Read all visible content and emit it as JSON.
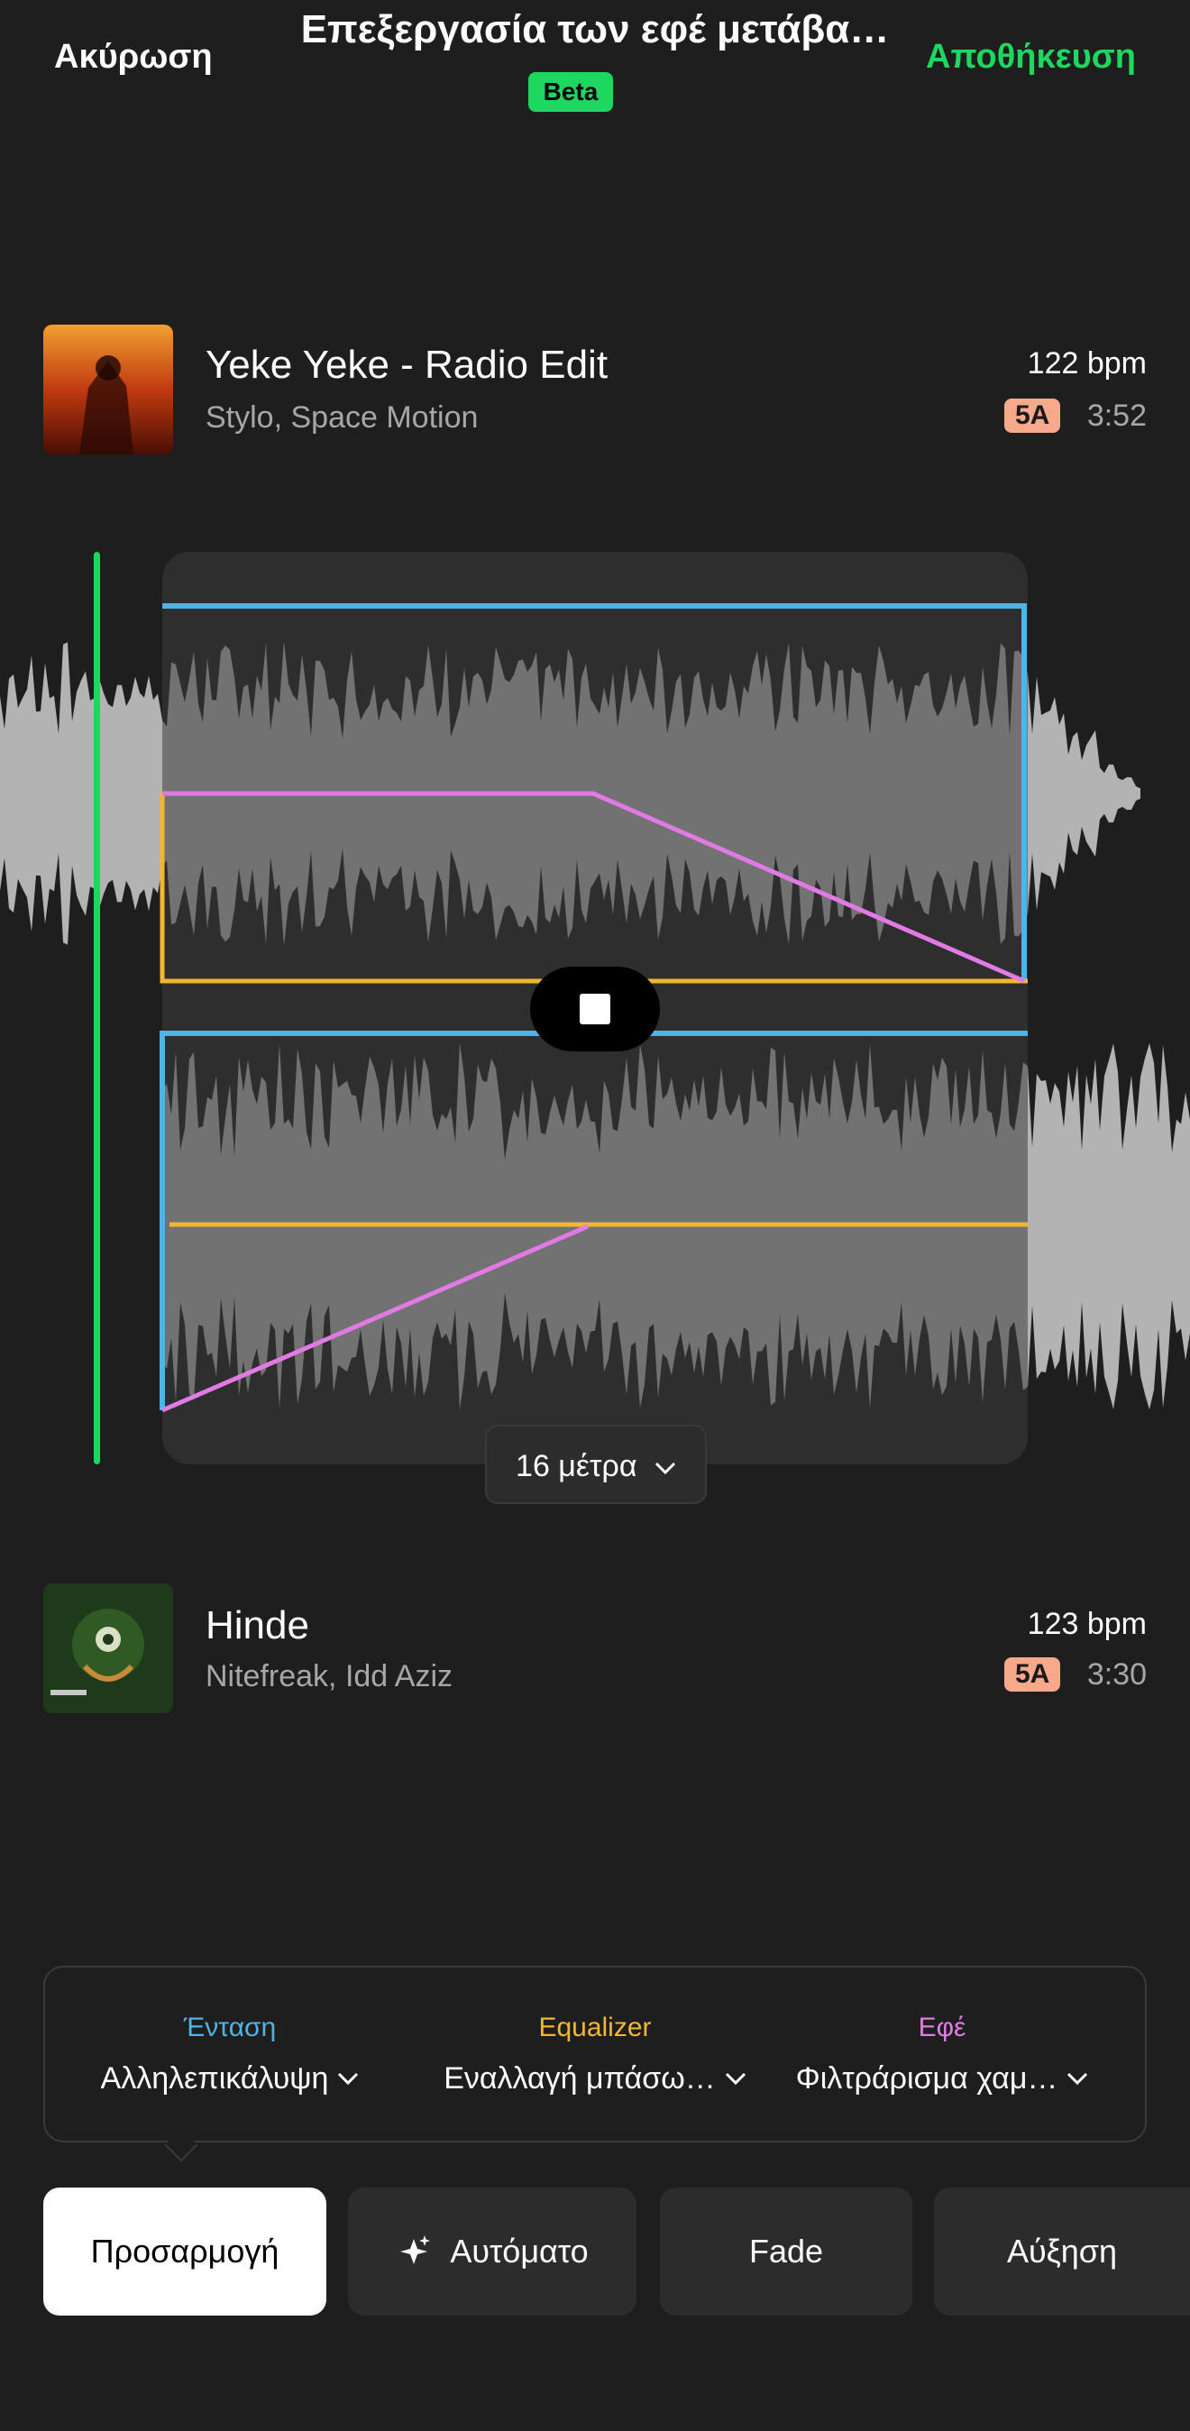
{
  "header": {
    "cancel_label": "Ακύρωση",
    "title": "Επεξεργασία των εφέ μετάβα…",
    "badge": "Beta",
    "save_label": "Αποθήκευση"
  },
  "tracks": [
    {
      "title": "Yeke Yeke - Radio Edit",
      "artists": "Stylo, Space Motion",
      "bpm": "122 bpm",
      "key": "5A",
      "duration": "3:52"
    },
    {
      "title": "Hinde",
      "artists": "Nitefreak, Idd Aziz",
      "bpm": "123 bpm",
      "key": "5A",
      "duration": "3:30"
    }
  ],
  "transition": {
    "length_label": "16 μέτρα",
    "stop_icon": "stop-icon",
    "curves": {
      "volume_color": "#4fb3e3",
      "equalizer_color": "#f2b632",
      "effects_color": "#e27ae5"
    }
  },
  "effects": [
    {
      "label": "Ένταση",
      "value": "Αλληλεπικάλυψη",
      "color": "#4fb3e3"
    },
    {
      "label": "Equalizer",
      "value": "Εναλλαγή μπάσω…",
      "color": "#f2b632"
    },
    {
      "label": "Εφέ",
      "value": "Φιλτράρισμα χαμ…",
      "color": "#e27ae5"
    }
  ],
  "presets": {
    "custom": "Προσαρμογή",
    "auto": "Αυτόματο",
    "fade": "Fade",
    "rise": "Αύξηση"
  },
  "colors": {
    "accent": "#1ed760",
    "background": "#1e1e1e",
    "key_badge": "#f7a98c"
  }
}
